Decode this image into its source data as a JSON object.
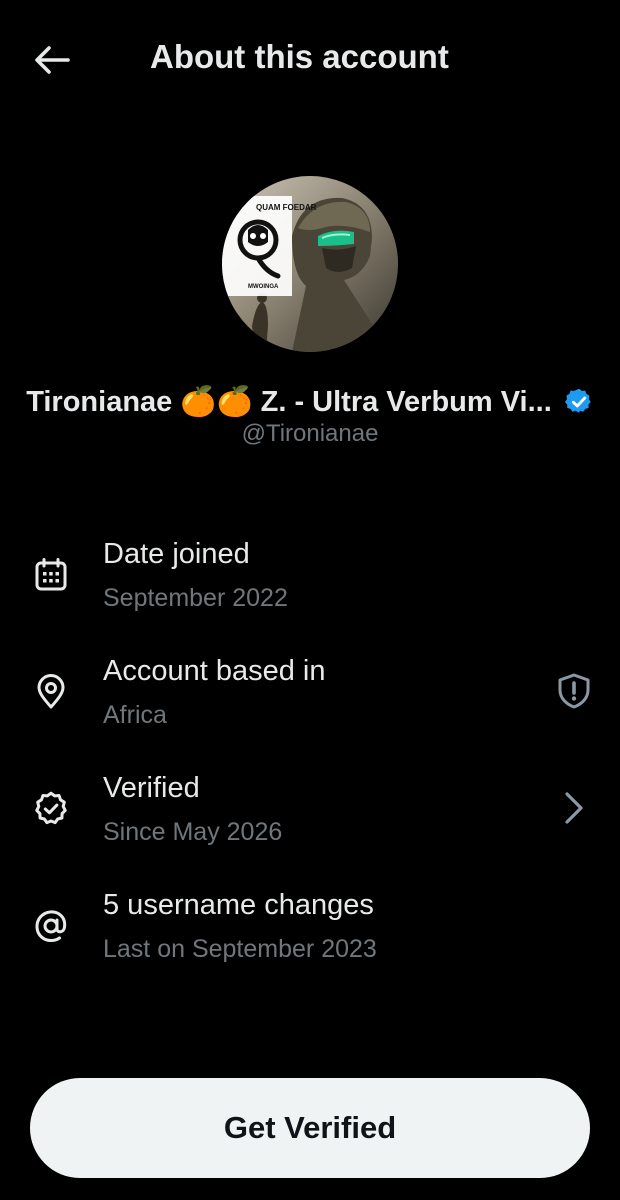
{
  "header": {
    "title": "About this account",
    "back_icon": "arrow-left-icon"
  },
  "profile": {
    "display_name": "Tironianae 🍊🍊 Z. - Ultra Verbum Vi...",
    "handle": "@Tironianae",
    "avatar_text_top": "QUAM FOEDAR",
    "avatar_text_bottom": "MWOINGA",
    "verified_badge_color": "#1d9bf0"
  },
  "details": [
    {
      "icon": "calendar-icon",
      "title": "Date joined",
      "subtitle": "September 2022",
      "trail_icon": ""
    },
    {
      "icon": "location-pin-icon",
      "title": "Account based in",
      "subtitle": "Africa",
      "trail_icon": "shield-alert-icon"
    },
    {
      "icon": "verified-check-icon",
      "title": "Verified",
      "subtitle": "Since May 2026",
      "trail_icon": "chevron-right-icon"
    },
    {
      "icon": "at-sign-icon",
      "title": "5 username changes",
      "subtitle": "Last on September 2023",
      "trail_icon": ""
    }
  ],
  "cta": {
    "label": "Get Verified"
  },
  "colors": {
    "background": "#000000",
    "primary_text": "#e7e9ea",
    "secondary_text": "#71767b",
    "button_bg": "#eff3f4",
    "button_text": "#0f1419"
  }
}
